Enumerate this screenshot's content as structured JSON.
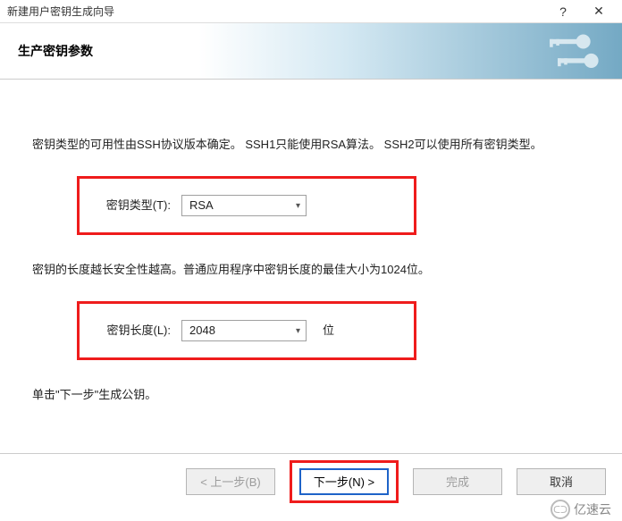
{
  "titlebar": {
    "title": "新建用户密钥生成向导",
    "help_symbol": "?",
    "close_symbol": "✕"
  },
  "banner": {
    "heading": "生产密钥参数"
  },
  "content": {
    "desc_type": "密钥类型的可用性由SSH协议版本确定。 SSH1只能使用RSA算法。 SSH2可以使用所有密钥类型。",
    "key_type_label": "密钥类型(T):",
    "key_type_value": "RSA",
    "desc_length": "密钥的长度越长安全性越高。普通应用程序中密钥长度的最佳大小为1024位。",
    "key_length_label": "密钥长度(L):",
    "key_length_value": "2048",
    "key_length_unit": "位",
    "desc_next": "单击\"下一步\"生成公钥。"
  },
  "buttons": {
    "back": "< 上一步(B)",
    "next": "下一步(N) >",
    "finish": "完成",
    "cancel": "取消"
  },
  "watermark": {
    "icon": "ᑕᑐ",
    "text": "亿速云"
  }
}
